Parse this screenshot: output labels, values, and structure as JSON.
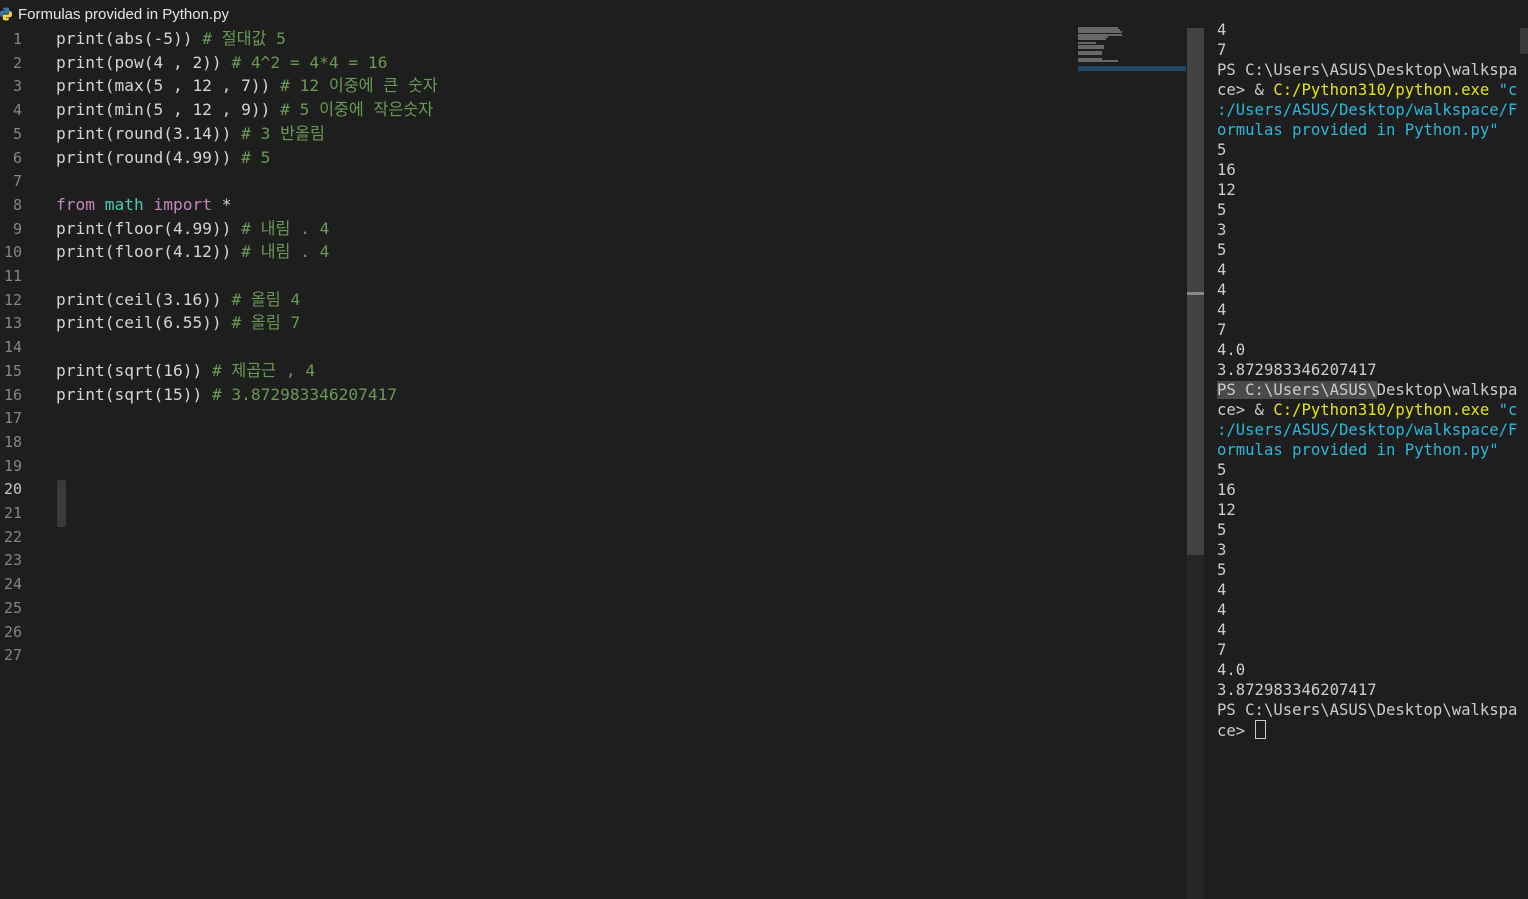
{
  "editor": {
    "file_title": "Formulas provided in Python.py",
    "current_line": 20,
    "line_numbers": [
      "1",
      "2",
      "3",
      "4",
      "5",
      "6",
      "7",
      "8",
      "9",
      "10",
      "11",
      "12",
      "13",
      "14",
      "15",
      "16",
      "17",
      "18",
      "19",
      "20",
      "21",
      "22",
      "23",
      "24",
      "25",
      "26",
      "27"
    ],
    "lines": [
      [
        {
          "t": "print(abs(-5)) ",
          "c": "plain"
        },
        {
          "t": "# 절대값 5",
          "c": "cmt"
        }
      ],
      [
        {
          "t": "print(pow(4 , 2)) ",
          "c": "plain"
        },
        {
          "t": "# 4^2 = 4*4 = 16",
          "c": "cmt"
        }
      ],
      [
        {
          "t": "print(max(5 , 12 , 7)) ",
          "c": "plain"
        },
        {
          "t": "# 12 이중에 큰 숫자",
          "c": "cmt"
        }
      ],
      [
        {
          "t": "print(min(5 , 12 , 9)) ",
          "c": "plain"
        },
        {
          "t": "# 5 이중에 작은숫자",
          "c": "cmt"
        }
      ],
      [
        {
          "t": "print(round(3.14)) ",
          "c": "plain"
        },
        {
          "t": "# 3 반올림",
          "c": "cmt"
        }
      ],
      [
        {
          "t": "print(round(4.99)) ",
          "c": "plain"
        },
        {
          "t": "# 5",
          "c": "cmt"
        }
      ],
      [],
      [
        {
          "t": "from",
          "c": "kw"
        },
        {
          "t": " ",
          "c": "plain"
        },
        {
          "t": "math",
          "c": "mod"
        },
        {
          "t": " ",
          "c": "plain"
        },
        {
          "t": "import",
          "c": "kw"
        },
        {
          "t": " *",
          "c": "plain"
        }
      ],
      [
        {
          "t": "print(floor(4.99)) ",
          "c": "plain"
        },
        {
          "t": "# 내림 . 4",
          "c": "cmt"
        }
      ],
      [
        {
          "t": "print(floor(4.12)) ",
          "c": "plain"
        },
        {
          "t": "# 내림 . 4",
          "c": "cmt"
        }
      ],
      [],
      [
        {
          "t": "print(ceil(3.16)) ",
          "c": "plain"
        },
        {
          "t": "# 올림 4",
          "c": "cmt"
        }
      ],
      [
        {
          "t": "print(ceil(6.55)) ",
          "c": "plain"
        },
        {
          "t": "# 올림 7",
          "c": "cmt"
        }
      ],
      [],
      [
        {
          "t": "print(sqrt(16)) ",
          "c": "plain"
        },
        {
          "t": "# 제곱근 , 4",
          "c": "cmt"
        }
      ],
      [
        {
          "t": "print(sqrt(15)) ",
          "c": "plain"
        },
        {
          "t": "# 3.872983346207417",
          "c": "cmt"
        }
      ],
      [],
      [],
      [],
      [],
      [],
      [],
      [],
      [],
      [],
      [],
      []
    ]
  },
  "terminal": {
    "lines": [
      [
        {
          "t": "4"
        }
      ],
      [
        {
          "t": "7"
        }
      ],
      [
        {
          "t": "PS C:\\Users\\ASUS\\Desktop\\walkspa"
        }
      ],
      [
        {
          "t": "ce> & "
        },
        {
          "t": "C:/Python310/python.exe",
          "c": "yel"
        },
        {
          "t": " \"c",
          "c": "cyan"
        }
      ],
      [
        {
          "t": ":/Users/ASUS/Desktop/walkspace/F",
          "c": "cyan"
        }
      ],
      [
        {
          "t": "ormulas provided in Python.py\"",
          "c": "cyan"
        }
      ],
      [
        {
          "t": "5"
        }
      ],
      [
        {
          "t": "16"
        }
      ],
      [
        {
          "t": "12"
        }
      ],
      [
        {
          "t": "5"
        }
      ],
      [
        {
          "t": "3"
        }
      ],
      [
        {
          "t": "5"
        }
      ],
      [
        {
          "t": "4"
        }
      ],
      [
        {
          "t": "4"
        }
      ],
      [
        {
          "t": "4"
        }
      ],
      [
        {
          "t": "7"
        }
      ],
      [
        {
          "t": "4.0"
        }
      ],
      [
        {
          "t": "3.872983346207417"
        }
      ],
      [
        {
          "t": "PS C:\\Users\\ASUS\\",
          "c": "sel"
        },
        {
          "t": "Desktop\\walkspa"
        }
      ],
      [
        {
          "t": "ce> & "
        },
        {
          "t": "C:/Python310/python.exe",
          "c": "yel"
        },
        {
          "t": " \"c",
          "c": "cyan"
        }
      ],
      [
        {
          "t": ":/Users/ASUS/Desktop/walkspace/F",
          "c": "cyan"
        }
      ],
      [
        {
          "t": "ormulas provided in Python.py\"",
          "c": "cyan"
        }
      ],
      [
        {
          "t": "5"
        }
      ],
      [
        {
          "t": "16"
        }
      ],
      [
        {
          "t": "12"
        }
      ],
      [
        {
          "t": "5"
        }
      ],
      [
        {
          "t": "3"
        }
      ],
      [
        {
          "t": "5"
        }
      ],
      [
        {
          "t": "4"
        }
      ],
      [
        {
          "t": "4"
        }
      ],
      [
        {
          "t": "4"
        }
      ],
      [
        {
          "t": "7"
        }
      ],
      [
        {
          "t": "4.0"
        }
      ],
      [
        {
          "t": "3.872983346207417"
        }
      ],
      [
        {
          "t": "PS C:\\Users\\ASUS\\Desktop\\walkspa"
        }
      ],
      [
        {
          "t": "ce> "
        },
        {
          "cursor": true
        }
      ]
    ]
  },
  "colors": {
    "editor_bg": "#1e1e1e",
    "keyword": "#c586c0",
    "module": "#4ec9b0",
    "comment": "#6a9955",
    "terminal_path": "#e5e510",
    "terminal_string": "#29b8db"
  },
  "icons": {
    "file_icon": "python-file-icon"
  }
}
